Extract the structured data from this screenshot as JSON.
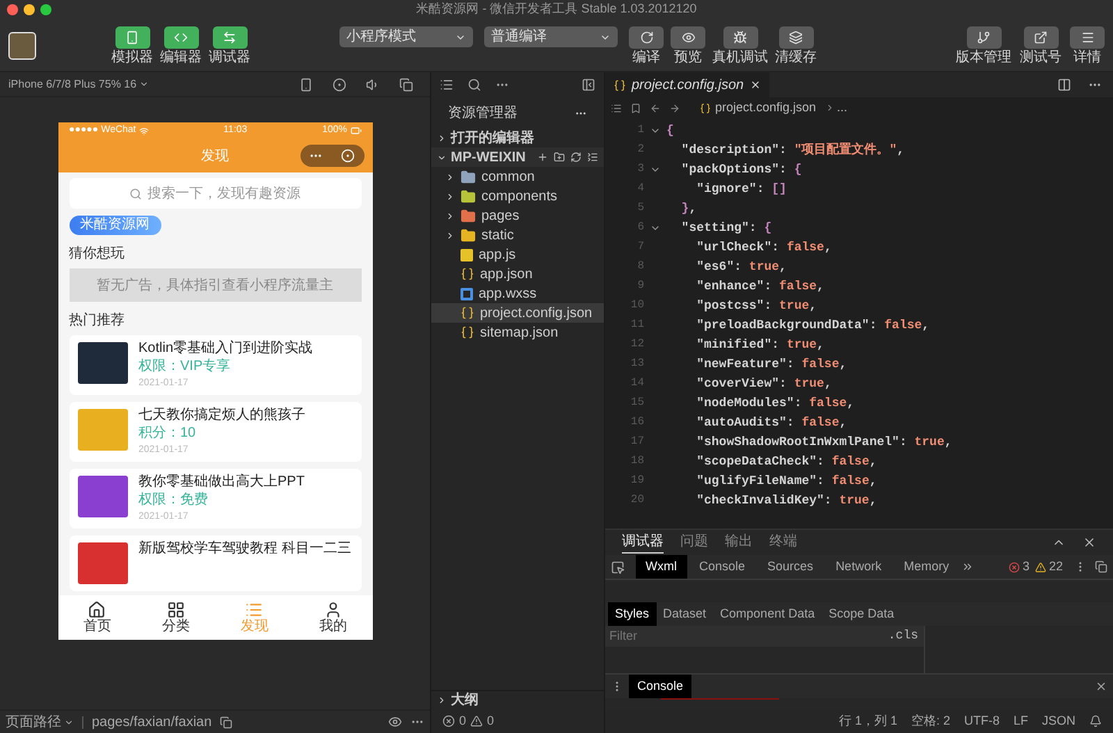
{
  "window": {
    "title": "米酷资源网 - 微信开发者工具 Stable 1.03.2012120"
  },
  "toolbar": {
    "view_buttons": [
      {
        "label": "模拟器",
        "kind": "phone"
      },
      {
        "label": "编辑器",
        "kind": "code"
      },
      {
        "label": "调试器",
        "kind": "swap"
      }
    ],
    "mode_select": {
      "value": "小程序模式"
    },
    "compile_select": {
      "value": "普通编译"
    },
    "actions": [
      {
        "label": "编译",
        "kind": "refresh"
      },
      {
        "label": "预览",
        "kind": "eye"
      },
      {
        "label": "真机调试",
        "kind": "bug"
      },
      {
        "label": "清缓存",
        "kind": "layers"
      }
    ],
    "right_buttons": [
      {
        "label": "版本管理",
        "kind": "branch"
      },
      {
        "label": "测试号",
        "kind": "external"
      },
      {
        "label": "详情",
        "kind": "menu"
      }
    ]
  },
  "simulator": {
    "device": "iPhone 6/7/8 Plus 75% 16",
    "phone": {
      "carrier": "●●●●● WeChat",
      "time": "11:03",
      "battery": "100%",
      "title": "发现",
      "search_placeholder": "搜索一下，发现有趣资源",
      "brand_tag": "米酷资源网",
      "guess_heading": "猜你想玩",
      "ad_text": "暂无广告，具体指引查看小程序流量主",
      "hot_heading": "热门推荐",
      "cards": [
        {
          "title": "Kotlin零基础入门到进阶实战",
          "meta": "权限：VIP专享",
          "date": "2021-01-17",
          "color": "#1f2a3a"
        },
        {
          "title": "七天教你搞定烦人的熊孩子",
          "meta": "积分：10",
          "date": "2021-01-17",
          "color": "#e8b020"
        },
        {
          "title": "教你零基础做出高大上PPT",
          "meta": "权限：免费",
          "date": "2021-01-17",
          "color": "#8a3fd0"
        },
        {
          "title": "新版驾校学车驾驶教程 科目一二三",
          "color": "#d83030"
        }
      ],
      "tabbar": [
        {
          "label": "首页",
          "kind": "home",
          "selected": false
        },
        {
          "label": "分类",
          "kind": "grid",
          "selected": false
        },
        {
          "label": "发现",
          "kind": "list",
          "selected": true
        },
        {
          "label": "我的",
          "kind": "user",
          "selected": false
        }
      ]
    },
    "page_path": {
      "label": "页面路径",
      "path": "pages/faxian/faxian"
    }
  },
  "explorer": {
    "title": "资源管理器",
    "sections": [
      {
        "label": "打开的编辑器",
        "expanded": false
      },
      {
        "label": "MP-WEIXIN",
        "expanded": true
      }
    ],
    "files": [
      {
        "name": "common",
        "kind": "folder",
        "color": "#8fa3bd",
        "selected": false
      },
      {
        "name": "components",
        "kind": "folder",
        "color": "#b7c43a",
        "selected": false
      },
      {
        "name": "pages",
        "kind": "folder",
        "color": "#e2704a",
        "selected": false
      },
      {
        "name": "static",
        "kind": "folder",
        "color": "#e6b422",
        "selected": false
      },
      {
        "name": "app.js",
        "kind": "js",
        "selected": false
      },
      {
        "name": "app.json",
        "kind": "json",
        "selected": false
      },
      {
        "name": "app.wxss",
        "kind": "css",
        "selected": false
      },
      {
        "name": "project.config.json",
        "kind": "json",
        "selected": true
      },
      {
        "name": "sitemap.json",
        "kind": "json",
        "selected": false
      }
    ],
    "outline": "大纲",
    "errors": "0",
    "warnings": "0"
  },
  "editor": {
    "tab": "project.config.json",
    "breadcrumb": [
      "project.config.json",
      "..."
    ],
    "lines": [
      {
        "number": "1",
        "fold": true,
        "tokens": [
          {
            "kind": "brace",
            "text": "{"
          }
        ]
      },
      {
        "number": "2",
        "fold": false,
        "tokens": [
          {
            "kind": "key",
            "text": "  \"description\""
          },
          {
            "kind": "punct",
            "text": ": "
          },
          {
            "kind": "str",
            "text": "\"项目配置文件。\""
          },
          {
            "kind": "punct",
            "text": ","
          }
        ]
      },
      {
        "number": "3",
        "fold": true,
        "tokens": [
          {
            "kind": "key",
            "text": "  \"packOptions\""
          },
          {
            "kind": "punct",
            "text": ": "
          },
          {
            "kind": "brace",
            "text": "{"
          }
        ]
      },
      {
        "number": "4",
        "fold": false,
        "tokens": [
          {
            "kind": "key",
            "text": "    \"ignore\""
          },
          {
            "kind": "punct",
            "text": ": "
          },
          {
            "kind": "brace",
            "text": "[]"
          }
        ]
      },
      {
        "number": "5",
        "fold": false,
        "tokens": [
          {
            "kind": "brace",
            "text": "  }"
          },
          {
            "kind": "punct",
            "text": ","
          }
        ]
      },
      {
        "number": "6",
        "fold": true,
        "tokens": [
          {
            "kind": "key",
            "text": "  \"setting\""
          },
          {
            "kind": "punct",
            "text": ": "
          },
          {
            "kind": "brace",
            "text": "{"
          }
        ]
      },
      {
        "number": "7",
        "fold": false,
        "tokens": [
          {
            "kind": "key",
            "text": "    \"urlCheck\""
          },
          {
            "kind": "punct",
            "text": ": "
          },
          {
            "kind": "bool",
            "text": "false"
          },
          {
            "kind": "punct",
            "text": ","
          }
        ]
      },
      {
        "number": "8",
        "fold": false,
        "tokens": [
          {
            "kind": "key",
            "text": "    \"es6\""
          },
          {
            "kind": "punct",
            "text": ": "
          },
          {
            "kind": "bool",
            "text": "true"
          },
          {
            "kind": "punct",
            "text": ","
          }
        ]
      },
      {
        "number": "9",
        "fold": false,
        "tokens": [
          {
            "kind": "key",
            "text": "    \"enhance\""
          },
          {
            "kind": "punct",
            "text": ": "
          },
          {
            "kind": "bool",
            "text": "false"
          },
          {
            "kind": "punct",
            "text": ","
          }
        ]
      },
      {
        "number": "10",
        "fold": false,
        "tokens": [
          {
            "kind": "key",
            "text": "    \"postcss\""
          },
          {
            "kind": "punct",
            "text": ": "
          },
          {
            "kind": "bool",
            "text": "true"
          },
          {
            "kind": "punct",
            "text": ","
          }
        ]
      },
      {
        "number": "11",
        "fold": false,
        "tokens": [
          {
            "kind": "key",
            "text": "    \"preloadBackgroundData\""
          },
          {
            "kind": "punct",
            "text": ": "
          },
          {
            "kind": "bool",
            "text": "false"
          },
          {
            "kind": "punct",
            "text": ","
          }
        ]
      },
      {
        "number": "12",
        "fold": false,
        "tokens": [
          {
            "kind": "key",
            "text": "    \"minified\""
          },
          {
            "kind": "punct",
            "text": ": "
          },
          {
            "kind": "bool",
            "text": "true"
          },
          {
            "kind": "punct",
            "text": ","
          }
        ]
      },
      {
        "number": "13",
        "fold": false,
        "tokens": [
          {
            "kind": "key",
            "text": "    \"newFeature\""
          },
          {
            "kind": "punct",
            "text": ": "
          },
          {
            "kind": "bool",
            "text": "false"
          },
          {
            "kind": "punct",
            "text": ","
          }
        ]
      },
      {
        "number": "14",
        "fold": false,
        "tokens": [
          {
            "kind": "key",
            "text": "    \"coverView\""
          },
          {
            "kind": "punct",
            "text": ": "
          },
          {
            "kind": "bool",
            "text": "true"
          },
          {
            "kind": "punct",
            "text": ","
          }
        ]
      },
      {
        "number": "15",
        "fold": false,
        "tokens": [
          {
            "kind": "key",
            "text": "    \"nodeModules\""
          },
          {
            "kind": "punct",
            "text": ": "
          },
          {
            "kind": "bool",
            "text": "false"
          },
          {
            "kind": "punct",
            "text": ","
          }
        ]
      },
      {
        "number": "16",
        "fold": false,
        "tokens": [
          {
            "kind": "key",
            "text": "    \"autoAudits\""
          },
          {
            "kind": "punct",
            "text": ": "
          },
          {
            "kind": "bool",
            "text": "false"
          },
          {
            "kind": "punct",
            "text": ","
          }
        ]
      },
      {
        "number": "17",
        "fold": false,
        "tokens": [
          {
            "kind": "key",
            "text": "    \"showShadowRootInWxmlPanel\""
          },
          {
            "kind": "punct",
            "text": ": "
          },
          {
            "kind": "bool",
            "text": "true"
          },
          {
            "kind": "punct",
            "text": ","
          }
        ]
      },
      {
        "number": "18",
        "fold": false,
        "tokens": [
          {
            "kind": "key",
            "text": "    \"scopeDataCheck\""
          },
          {
            "kind": "punct",
            "text": ": "
          },
          {
            "kind": "bool",
            "text": "false"
          },
          {
            "kind": "punct",
            "text": ","
          }
        ]
      },
      {
        "number": "19",
        "fold": false,
        "tokens": [
          {
            "kind": "key",
            "text": "    \"uglifyFileName\""
          },
          {
            "kind": "punct",
            "text": ": "
          },
          {
            "kind": "bool",
            "text": "false"
          },
          {
            "kind": "punct",
            "text": ","
          }
        ]
      },
      {
        "number": "20",
        "fold": false,
        "tokens": [
          {
            "kind": "key",
            "text": "    \"checkInvalidKey\""
          },
          {
            "kind": "punct",
            "text": ": "
          },
          {
            "kind": "bool",
            "text": "true"
          },
          {
            "kind": "punct",
            "text": ","
          }
        ]
      }
    ]
  },
  "devtools": {
    "panel_tabs": [
      {
        "label": "调试器",
        "selected": true
      },
      {
        "label": "问题",
        "selected": false
      },
      {
        "label": "输出",
        "selected": false
      },
      {
        "label": "终端",
        "selected": false
      }
    ],
    "tool_tabs": [
      {
        "label": "Wxml",
        "selected": true
      },
      {
        "label": "Console",
        "selected": false
      },
      {
        "label": "Sources",
        "selected": false
      },
      {
        "label": "Network",
        "selected": false
      },
      {
        "label": "Memory",
        "selected": false
      }
    ],
    "errors": "3",
    "warnings": "22",
    "sub_tabs": [
      {
        "label": "Styles",
        "selected": true
      },
      {
        "label": "Dataset",
        "selected": false
      },
      {
        "label": "Component Data",
        "selected": false
      },
      {
        "label": "Scope Data",
        "selected": false
      }
    ],
    "filter_placeholder": "Filter",
    "cls": ".cls",
    "drawer_tab": "Console"
  },
  "status_bar": [
    "行 1，列 1",
    "空格: 2",
    "UTF-8",
    "LF",
    "JSON"
  ]
}
